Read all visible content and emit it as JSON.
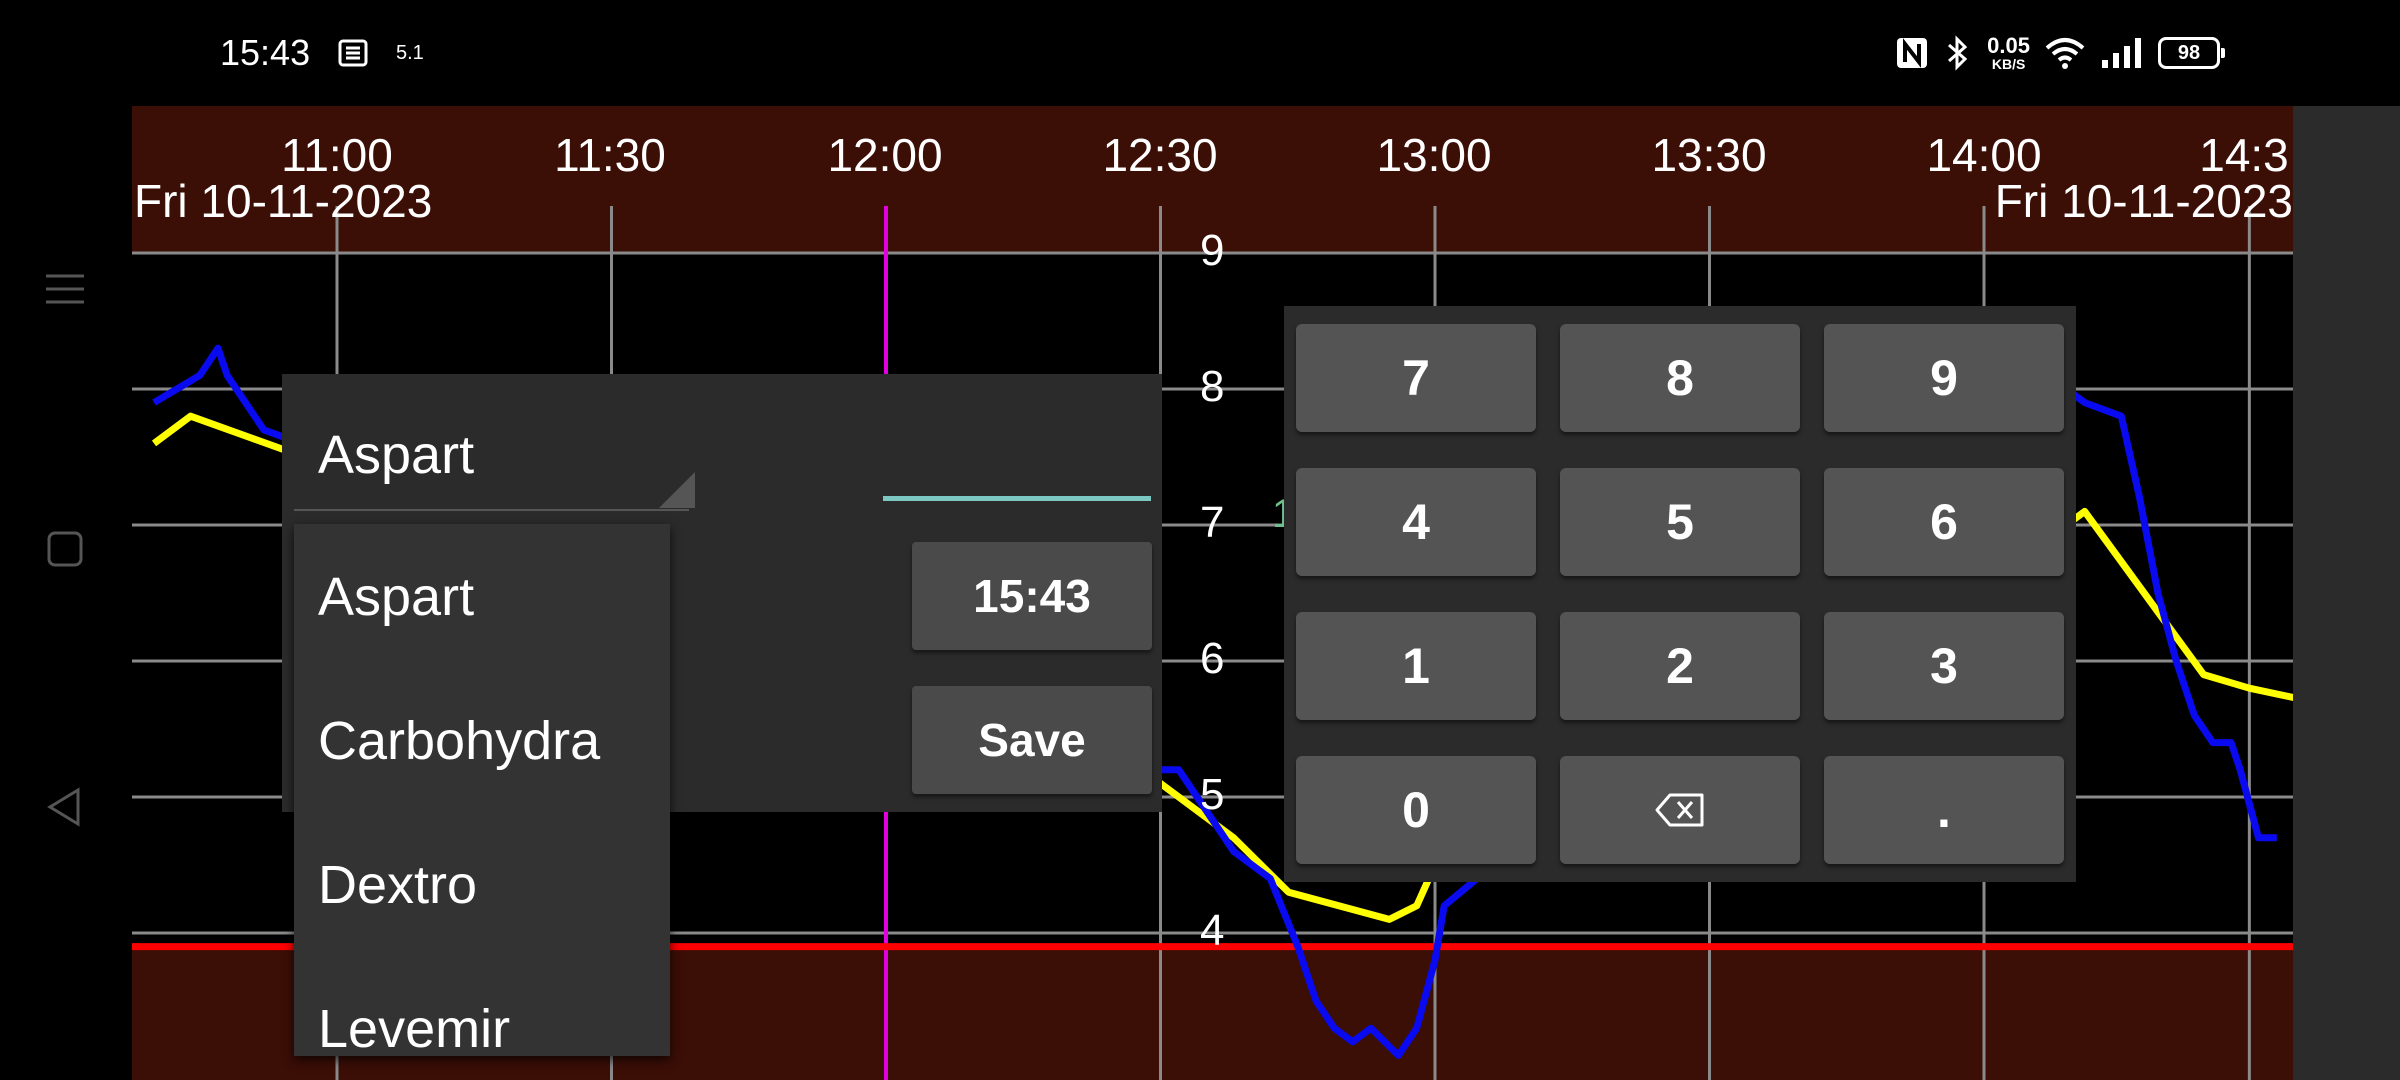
{
  "status_bar": {
    "time": "15:43",
    "notification_count": "5.1",
    "speed_value": "0.05",
    "speed_unit": "KB/S",
    "battery": "98"
  },
  "chart_data": {
    "type": "line",
    "title": "",
    "x_ticks": [
      "11:00",
      "11:30",
      "12:00",
      "12:30",
      "13:00",
      "13:30",
      "14:00",
      "14:3"
    ],
    "date_left": "Fri 10-11-2023",
    "date_right": "Fri 10-11-2023",
    "y_ticks": [
      "9",
      "8",
      "7",
      "6",
      "5",
      "4"
    ],
    "green_tick": "1",
    "ylim": [
      3.5,
      9.0
    ],
    "now_line_x": "12:00",
    "low_threshold": 3.9,
    "colors": {
      "background": "#000000",
      "out_of_range_fill": "#3b0e06",
      "grid": "#8a8a8a",
      "now_line": "#e000e0",
      "low_line": "#ff0000",
      "glucose": "#0a0af0",
      "prediction": "#ffff00"
    },
    "series": [
      {
        "values_x": [
          "10:40",
          "10:45",
          "10:47",
          "10:48",
          "10:50",
          "10:52",
          "10:56",
          "10:58",
          "10:59",
          "11:02",
          "11:05",
          "11:07",
          "11:13",
          "12:30",
          "12:32",
          "12:34",
          "12:38",
          "12:42",
          "12:45",
          "12:47",
          "12:49",
          "12:51",
          "12:53",
          "12:56",
          "12:58",
          "13:00",
          "13:01",
          "14:09",
          "14:11",
          "14:15",
          "14:17",
          "14:19",
          "14:21",
          "14:23",
          "14:25",
          "14:27",
          "14:28",
          "14:30",
          "14:32"
        ],
        "values_y": [
          7.9,
          8.1,
          8.3,
          8.1,
          7.9,
          7.7,
          7.6,
          7.5,
          7.5,
          7.6,
          7.6,
          7.5,
          7.4,
          5.2,
          5.2,
          5.0,
          4.6,
          4.4,
          3.9,
          3.5,
          3.3,
          3.2,
          3.3,
          3.1,
          3.3,
          3.8,
          4.2,
          8.0,
          7.9,
          7.8,
          7.2,
          6.5,
          6.0,
          5.6,
          5.4,
          5.4,
          5.2,
          4.7,
          4.7
        ]
      },
      {
        "values_x": [
          "10:40",
          "10:44",
          "11:13",
          "12:30",
          "12:38",
          "12:44",
          "12:55",
          "12:58",
          "13:00",
          "14:09",
          "14:11",
          "14:24",
          "14:29",
          "14:36"
        ],
        "values_y": [
          7.6,
          7.8,
          7.1,
          5.1,
          4.7,
          4.3,
          4.1,
          4.2,
          4.5,
          7.0,
          7.1,
          5.9,
          5.8,
          5.7
        ]
      }
    ]
  },
  "dialog": {
    "selected_type": "Aspart",
    "time_button": "15:43",
    "save_button": "Save"
  },
  "dropdown": {
    "options": [
      "Aspart",
      "Carbohydra",
      "Dextro",
      "Levemir"
    ]
  },
  "keypad": {
    "keys": [
      "7",
      "8",
      "9",
      "4",
      "5",
      "6",
      "1",
      "2",
      "3",
      "0",
      "backspace",
      "."
    ]
  }
}
